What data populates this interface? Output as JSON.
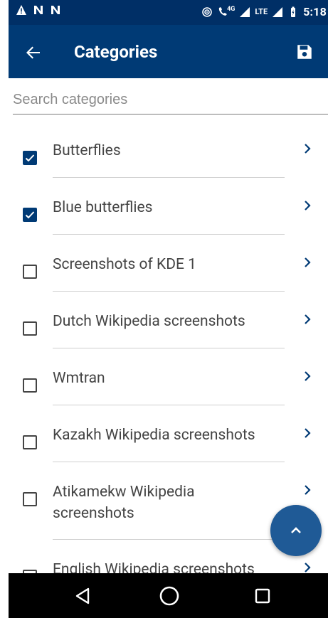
{
  "status_bar": {
    "time": "5:18",
    "network_labels": [
      "4G",
      "LTE"
    ]
  },
  "app_bar": {
    "title": "Categories"
  },
  "search": {
    "placeholder": "Search categories",
    "value": ""
  },
  "categories": [
    {
      "label": "Butterflies",
      "checked": true
    },
    {
      "label": "Blue butterflies",
      "checked": true
    },
    {
      "label": "Screenshots of KDE 1",
      "checked": false
    },
    {
      "label": "Dutch Wikipedia screenshots",
      "checked": false
    },
    {
      "label": "Wmtran",
      "checked": false
    },
    {
      "label": "Kazakh Wikipedia screenshots",
      "checked": false
    },
    {
      "label": "Atikamekw Wikipedia screenshots",
      "checked": false
    },
    {
      "label": "English Wikipedia screenshots",
      "checked": false
    }
  ],
  "colors": {
    "status_bar": "#002f66",
    "app_bar": "#003a75",
    "accent": "#003a75",
    "fab": "#1f5a96"
  },
  "icons": {
    "back": "arrow-left-icon",
    "save": "save-icon",
    "chevron": "chevron-right-icon",
    "fab": "chevron-up-icon",
    "nav_back": "triangle-back-icon",
    "nav_home": "circle-home-icon",
    "nav_recents": "square-recents-icon"
  }
}
